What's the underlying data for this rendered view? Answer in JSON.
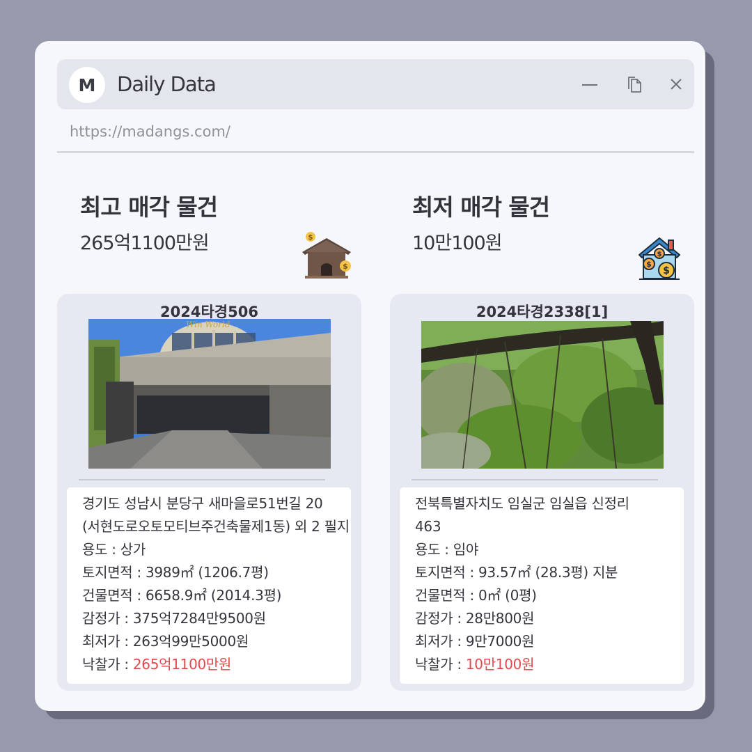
{
  "app": {
    "logo_letter": "M",
    "title": "Daily Data",
    "url": "https://madangs.com/"
  },
  "window_controls": {
    "minimize_icon": "minimize-icon",
    "copy_icon": "copy-icon",
    "close_icon": "close-icon"
  },
  "highest": {
    "heading": "최고 매각 물건",
    "price": "265억1100만원",
    "icon": "house-money-icon",
    "case_number": "2024타경506",
    "address_line1": "경기도 성남시 분당구 새마을로51번길 20",
    "address_line2": "(서현도로오토모티브주건축물제1동) 외 2 필지",
    "usage": "용도 : 상가",
    "land_area": "토지면적 : 3989㎡ (1206.7평)",
    "building_area": "건물면적 : 6658.9㎡ (2014.3평)",
    "appraisal": "감정가 : 375억7284만9500원",
    "minimum": "최저가 : 263억99만5000원",
    "winning_label": "낙찰가 : ",
    "winning_value": "265억1100만원"
  },
  "lowest": {
    "heading": "최저 매각 물건",
    "price": "10만100원",
    "icon": "house-coins-icon",
    "case_number": "2024타경2338[1]",
    "address_line1": "전북특별자치도 임실군 임실읍 신정리",
    "address_line2": "463",
    "usage": "용도 :  임야",
    "land_area": "토지면적 : 93.57㎡ (28.3평) 지분",
    "building_area": "건물면적 : 0㎡ (0평)",
    "appraisal": "감정가 : 28만800원",
    "minimum": "최저가 : 9만7000원",
    "winning_label": "낙찰가 : ",
    "winning_value": "10만100원"
  },
  "colors": {
    "background": "#9799ad",
    "window": "#f6f7fb",
    "titlebar": "#e4e6ee",
    "panel": "#e7e9f2",
    "accent_red": "#e2484b"
  }
}
